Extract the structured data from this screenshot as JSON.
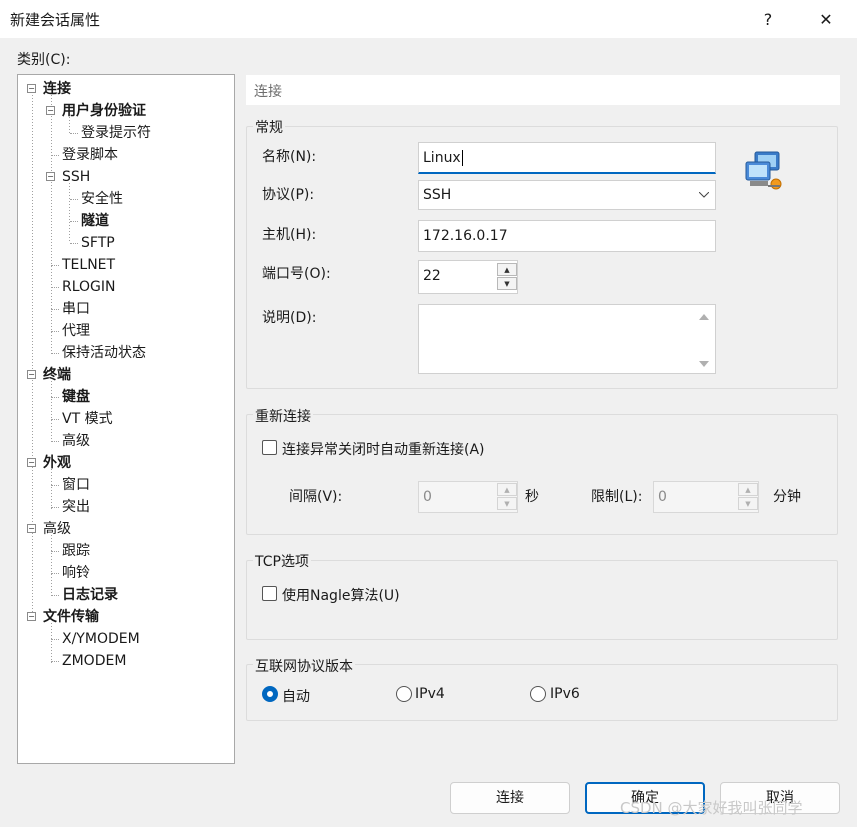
{
  "window": {
    "title": "新建会话属性",
    "help": "?",
    "close": "✕"
  },
  "category_label": "类别(C):",
  "tree": [
    {
      "label": "连接",
      "bold": true,
      "selected": true,
      "toggle": "−",
      "level": 0
    },
    {
      "label": "用户身份验证",
      "bold": true,
      "toggle": "−",
      "level": 1
    },
    {
      "label": "登录提示符",
      "bold": false,
      "level": 2
    },
    {
      "label": "登录脚本",
      "bold": false,
      "level": 1
    },
    {
      "label": "SSH",
      "bold": false,
      "toggle": "−",
      "level": 1
    },
    {
      "label": "安全性",
      "bold": false,
      "level": 2
    },
    {
      "label": "隧道",
      "bold": true,
      "level": 2
    },
    {
      "label": "SFTP",
      "bold": false,
      "level": 2
    },
    {
      "label": "TELNET",
      "bold": false,
      "level": 1
    },
    {
      "label": "RLOGIN",
      "bold": false,
      "level": 1
    },
    {
      "label": "串口",
      "bold": false,
      "level": 1
    },
    {
      "label": "代理",
      "bold": false,
      "level": 1
    },
    {
      "label": "保持活动状态",
      "bold": false,
      "level": 1
    },
    {
      "label": "终端",
      "bold": true,
      "toggle": "−",
      "level": 0
    },
    {
      "label": "键盘",
      "bold": true,
      "level": 1
    },
    {
      "label": "VT 模式",
      "bold": false,
      "level": 1
    },
    {
      "label": "高级",
      "bold": false,
      "level": 1
    },
    {
      "label": "外观",
      "bold": true,
      "toggle": "−",
      "level": 0
    },
    {
      "label": "窗口",
      "bold": false,
      "level": 1
    },
    {
      "label": "突出",
      "bold": false,
      "level": 1
    },
    {
      "label": "高级",
      "bold": false,
      "toggle": "−",
      "level": 0
    },
    {
      "label": "跟踪",
      "bold": false,
      "level": 1
    },
    {
      "label": "响铃",
      "bold": false,
      "level": 1
    },
    {
      "label": "日志记录",
      "bold": true,
      "level": 1
    },
    {
      "label": "文件传输",
      "bold": true,
      "toggle": "−",
      "level": 0
    },
    {
      "label": "X/YMODEM",
      "bold": false,
      "level": 1
    },
    {
      "label": "ZMODEM",
      "bold": false,
      "level": 1
    }
  ],
  "panel_header": "连接",
  "general": {
    "group_label": "常规",
    "name_label": "名称(N):",
    "name_value": "Linux",
    "protocol_label": "协议(P):",
    "protocol_value": "SSH",
    "host_label": "主机(H):",
    "host_value": "172.16.0.17",
    "port_label": "端口号(O):",
    "port_value": "22",
    "desc_label": "说明(D):",
    "desc_value": ""
  },
  "reconnect": {
    "group_label": "重新连接",
    "checkbox_label": "连接异常关闭时自动重新连接(A)",
    "interval_label": "间隔(V):",
    "interval_value": "0",
    "interval_unit": "秒",
    "limit_label": "限制(L):",
    "limit_value": "0",
    "limit_unit": "分钟"
  },
  "tcp": {
    "group_label": "TCP选项",
    "nagle_label": "使用Nagle算法(U)"
  },
  "ipver": {
    "group_label": "互联网协议版本",
    "auto": "自动",
    "ipv4": "IPv4",
    "ipv6": "IPv6"
  },
  "buttons": {
    "connect": "连接",
    "ok": "确定",
    "cancel": "取消"
  },
  "watermark": "CSDN @大家好我叫张同学"
}
